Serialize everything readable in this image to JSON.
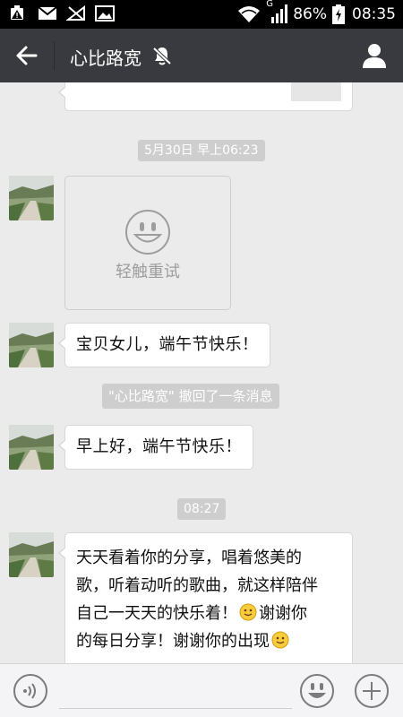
{
  "status_bar": {
    "network_type": "G",
    "battery": "86%",
    "time": "08:35",
    "icons": [
      "warning-notification-icon",
      "mail-icon",
      "sim-no-signal-icon",
      "image-icon",
      "wifi-icon",
      "signal-icon",
      "battery-charging-icon"
    ]
  },
  "header": {
    "back_icon": "arrow-left-icon",
    "title": "心比路宽",
    "mute_icon": "bell-off-icon",
    "profile_icon": "person-icon",
    "bg_color": "#393a3f"
  },
  "chat": {
    "messages": [
      {
        "type": "time",
        "text": "5月30日 早上06:23"
      },
      {
        "type": "failed_image",
        "label": "轻触重试"
      },
      {
        "type": "text",
        "text": "宝贝女儿，端午节快乐！"
      },
      {
        "type": "notice",
        "text": "\"心比路宽\" 撤回了一条消息"
      },
      {
        "type": "text",
        "text": "早上好，端午节快乐！"
      },
      {
        "type": "time",
        "text": "08:27"
      },
      {
        "type": "text",
        "lines": [
          "天天看着你的分享，唱着悠美的",
          "歌，听着动听的歌曲，就这样陪伴",
          "自己一天天的快乐着！",
          "谢谢你",
          "的每日分享！谢谢你的出现"
        ],
        "emoji": "smile-emoji-icon"
      }
    ]
  },
  "input_bar": {
    "voice_icon": "voice-icon",
    "emoji_icon": "emoji-face-icon",
    "plus_icon": "plus-circle-icon",
    "placeholder": ""
  }
}
